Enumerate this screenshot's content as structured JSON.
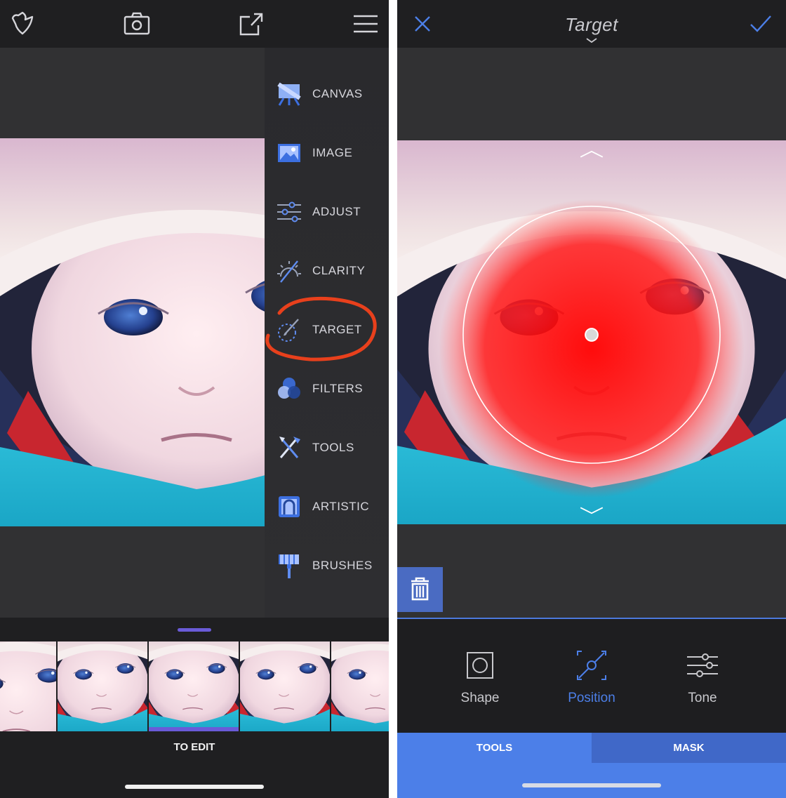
{
  "left": {
    "topbar": {
      "icons": [
        "bird-logo-icon",
        "camera-icon",
        "share-export-icon",
        "hamburger-menu-icon"
      ]
    },
    "menu": {
      "items": [
        {
          "label": "CANVAS",
          "icon": "canvas-easel-icon"
        },
        {
          "label": "IMAGE",
          "icon": "image-icon"
        },
        {
          "label": "ADJUST",
          "icon": "sliders-icon"
        },
        {
          "label": "CLARITY",
          "icon": "clarity-icon"
        },
        {
          "label": "TARGET",
          "icon": "target-brush-icon"
        },
        {
          "label": "FILTERS",
          "icon": "filters-icon"
        },
        {
          "label": "TOOLS",
          "icon": "tools-icon"
        },
        {
          "label": "ARTISTIC",
          "icon": "artistic-frame-icon"
        },
        {
          "label": "BRUSHES",
          "icon": "brush-icon"
        }
      ],
      "highlighted": "TARGET",
      "highlight_color": "#e8401c"
    },
    "tray": {
      "label": "TO EDIT",
      "accent": "#6a5bd8",
      "active_thumb_index": 2
    }
  },
  "right": {
    "topbar": {
      "title": "Target",
      "icons": [
        "close-icon",
        "chevron-down-icon",
        "checkmark-icon"
      ]
    },
    "overlay": {
      "mask_color": "#ff1a1a",
      "arrows": [
        "chevron-up-icon",
        "chevron-down-icon"
      ]
    },
    "trash_icon": "trash-icon",
    "tools": [
      {
        "label": "Shape",
        "icon": "shape-circle-icon",
        "active": false
      },
      {
        "label": "Position",
        "icon": "position-icon",
        "active": true
      },
      {
        "label": "Tone",
        "icon": "tone-sliders-icon",
        "active": false
      }
    ],
    "tabs": {
      "tools_label": "TOOLS",
      "mask_label": "MASK",
      "accent": "#4c7fe8"
    }
  }
}
